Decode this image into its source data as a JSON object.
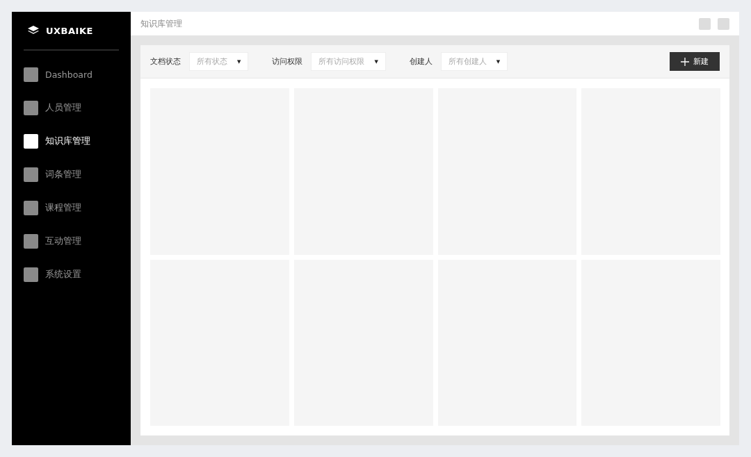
{
  "sidebar": {
    "logo": "UXBAIKE",
    "items": [
      {
        "label": "Dashboard",
        "selected": false
      },
      {
        "label": "人员管理",
        "selected": false
      },
      {
        "label": "知识库管理",
        "selected": true
      },
      {
        "label": "词条管理",
        "selected": false
      },
      {
        "label": "课程管理",
        "selected": false
      },
      {
        "label": "互动管理",
        "selected": false
      },
      {
        "label": "系统设置",
        "selected": false
      }
    ]
  },
  "header": {
    "title": "知识库管理"
  },
  "filters": [
    {
      "label": "文档状态",
      "value": "所有状态",
      "caret": "▼"
    },
    {
      "label": "访问权限",
      "value": "所有访问权限",
      "caret": "▼"
    },
    {
      "label": "创建人",
      "value": "所有创建人",
      "caret": "▼"
    }
  ],
  "new_button": {
    "label": "新建"
  },
  "cards": [
    {
      "kind": "placeholder"
    },
    {
      "kind": "placeholder"
    },
    {
      "kind": "placeholder"
    },
    {
      "kind": "placeholder"
    },
    {
      "kind": "placeholder"
    },
    {
      "kind": "placeholder"
    },
    {
      "kind": "placeholder"
    },
    {
      "kind": "placeholder"
    }
  ]
}
